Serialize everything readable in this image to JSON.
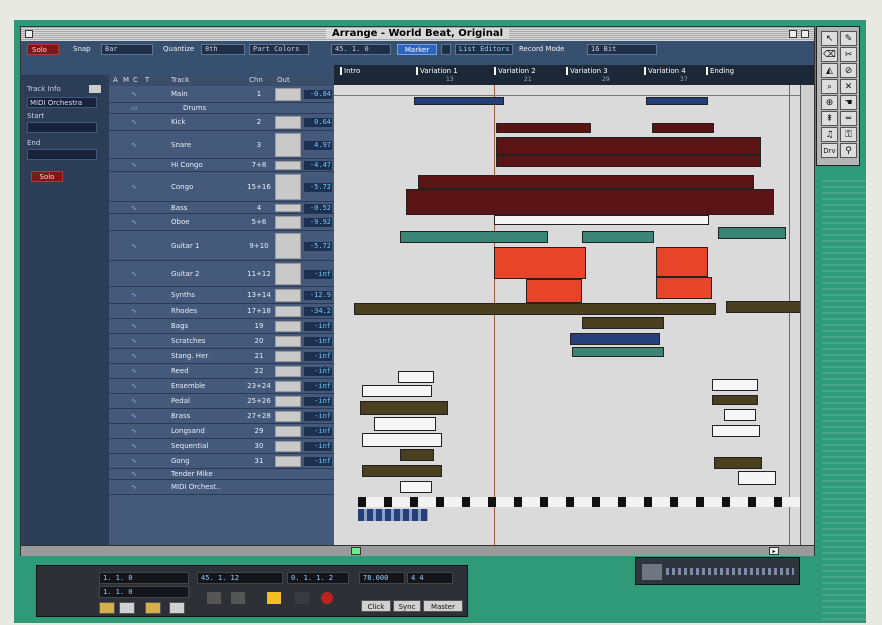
{
  "window": {
    "title": "Arrange - World Beat, Original"
  },
  "toolbar": {
    "solo": "Solo",
    "snap_label": "Snap",
    "snap_value": "Bar",
    "quantize_label": "Quantize",
    "quantize_value": "8th",
    "part_colors": "Part Colors",
    "position": "45. 1. 0",
    "marker_button": "Marker",
    "list_editors": "List Editors",
    "record_mode_label": "Record Mode",
    "record_mode_value": "16 Bit"
  },
  "inspector": {
    "track_info": "Track Info",
    "instrument": "MIDI Orchestra",
    "start_label": "Start",
    "end_label": "End",
    "solo": "Solo"
  },
  "track_header": {
    "cols": [
      "A",
      "M",
      "C",
      "T",
      "Track",
      "Chn",
      "Out"
    ]
  },
  "tracks": [
    {
      "name": "Main",
      "chn": "1",
      "out": "-0.84",
      "h": 17
    },
    {
      "name": "Drums",
      "chn": "",
      "out": "",
      "h": 11,
      "folder": true
    },
    {
      "name": "Kick",
      "chn": "2",
      "out": "0.64",
      "h": 17
    },
    {
      "name": "Snare",
      "chn": "3",
      "out": "4.97",
      "h": 28
    },
    {
      "name": "Hi Congo",
      "chn": "7+8",
      "out": "-4.47",
      "h": 13
    },
    {
      "name": "Congo",
      "chn": "15+16",
      "out": "-5.72",
      "h": 30
    },
    {
      "name": "Bass",
      "chn": "4",
      "out": "-0.52",
      "h": 12
    },
    {
      "name": "Oboe",
      "chn": "5+6",
      "out": "-9.92",
      "h": 17
    },
    {
      "name": "Guitar 1",
      "chn": "9+10",
      "out": "-5.72",
      "h": 30
    },
    {
      "name": "Guitar 2",
      "chn": "11+12",
      "out": "-inf",
      "h": 26
    },
    {
      "name": "Synths",
      "chn": "13+14",
      "out": "-12.9",
      "h": 17
    },
    {
      "name": "Rhodes",
      "chn": "17+18",
      "out": "-34.2",
      "h": 15
    },
    {
      "name": "Bags",
      "chn": "19",
      "out": "-inf",
      "h": 15
    },
    {
      "name": "Scratches",
      "chn": "20",
      "out": "-inf",
      "h": 15
    },
    {
      "name": "Stang. Her",
      "chn": "21",
      "out": "-inf",
      "h": 15
    },
    {
      "name": "Reed",
      "chn": "22",
      "out": "-inf",
      "h": 15
    },
    {
      "name": "Ensemble",
      "chn": "23+24",
      "out": "-inf",
      "h": 15
    },
    {
      "name": "Pedal",
      "chn": "25+26",
      "out": "-inf",
      "h": 15
    },
    {
      "name": "Brass",
      "chn": "27+28",
      "out": "-inf",
      "h": 15
    },
    {
      "name": "Longsand",
      "chn": "29",
      "out": "-inf",
      "h": 15
    },
    {
      "name": "Sequential",
      "chn": "30",
      "out": "-inf",
      "h": 15
    },
    {
      "name": "Gong",
      "chn": "31",
      "out": "-inf",
      "h": 15
    },
    {
      "name": "Tender Mike",
      "chn": "",
      "out": "",
      "h": 11
    },
    {
      "name": "MIDI Orchest..",
      "chn": "",
      "out": "",
      "h": 15
    }
  ],
  "ruler": {
    "markers": [
      "Intro",
      "Variation 1",
      "Variation 2",
      "Variation 3",
      "Variation 4",
      "Ending"
    ],
    "numbers": [
      "13",
      "21",
      "29",
      "37"
    ]
  },
  "colors": {
    "teal": "#2f9a78",
    "dark_red": "#5a1414",
    "bright_red": "#e6452a",
    "teal_part": "#3b8577",
    "navy_part": "#263f7a",
    "olive_part": "#4a3f1e"
  },
  "toolbox": {
    "icons": [
      "arrow-icon",
      "pencil-icon",
      "eraser-icon",
      "scissors-icon",
      "glue-icon",
      "mute-icon",
      "magnify-icon",
      "delete-icon",
      "zoom-icon",
      "hand-icon",
      "marker-icon",
      "line-icon",
      "note-icon",
      "key-icon",
      "drv-icon",
      "audition-icon"
    ],
    "drv_label": "Drv"
  },
  "transport": {
    "left_pos": "1. 1. 0",
    "right_pos": "1. 1. 0",
    "song_pos": "45. 1. 12",
    "smpte": "0. 1. 1. 2",
    "tempo": "78.000",
    "signature": "4 4",
    "click": "Click",
    "sync": "Sync",
    "master": "Master"
  }
}
